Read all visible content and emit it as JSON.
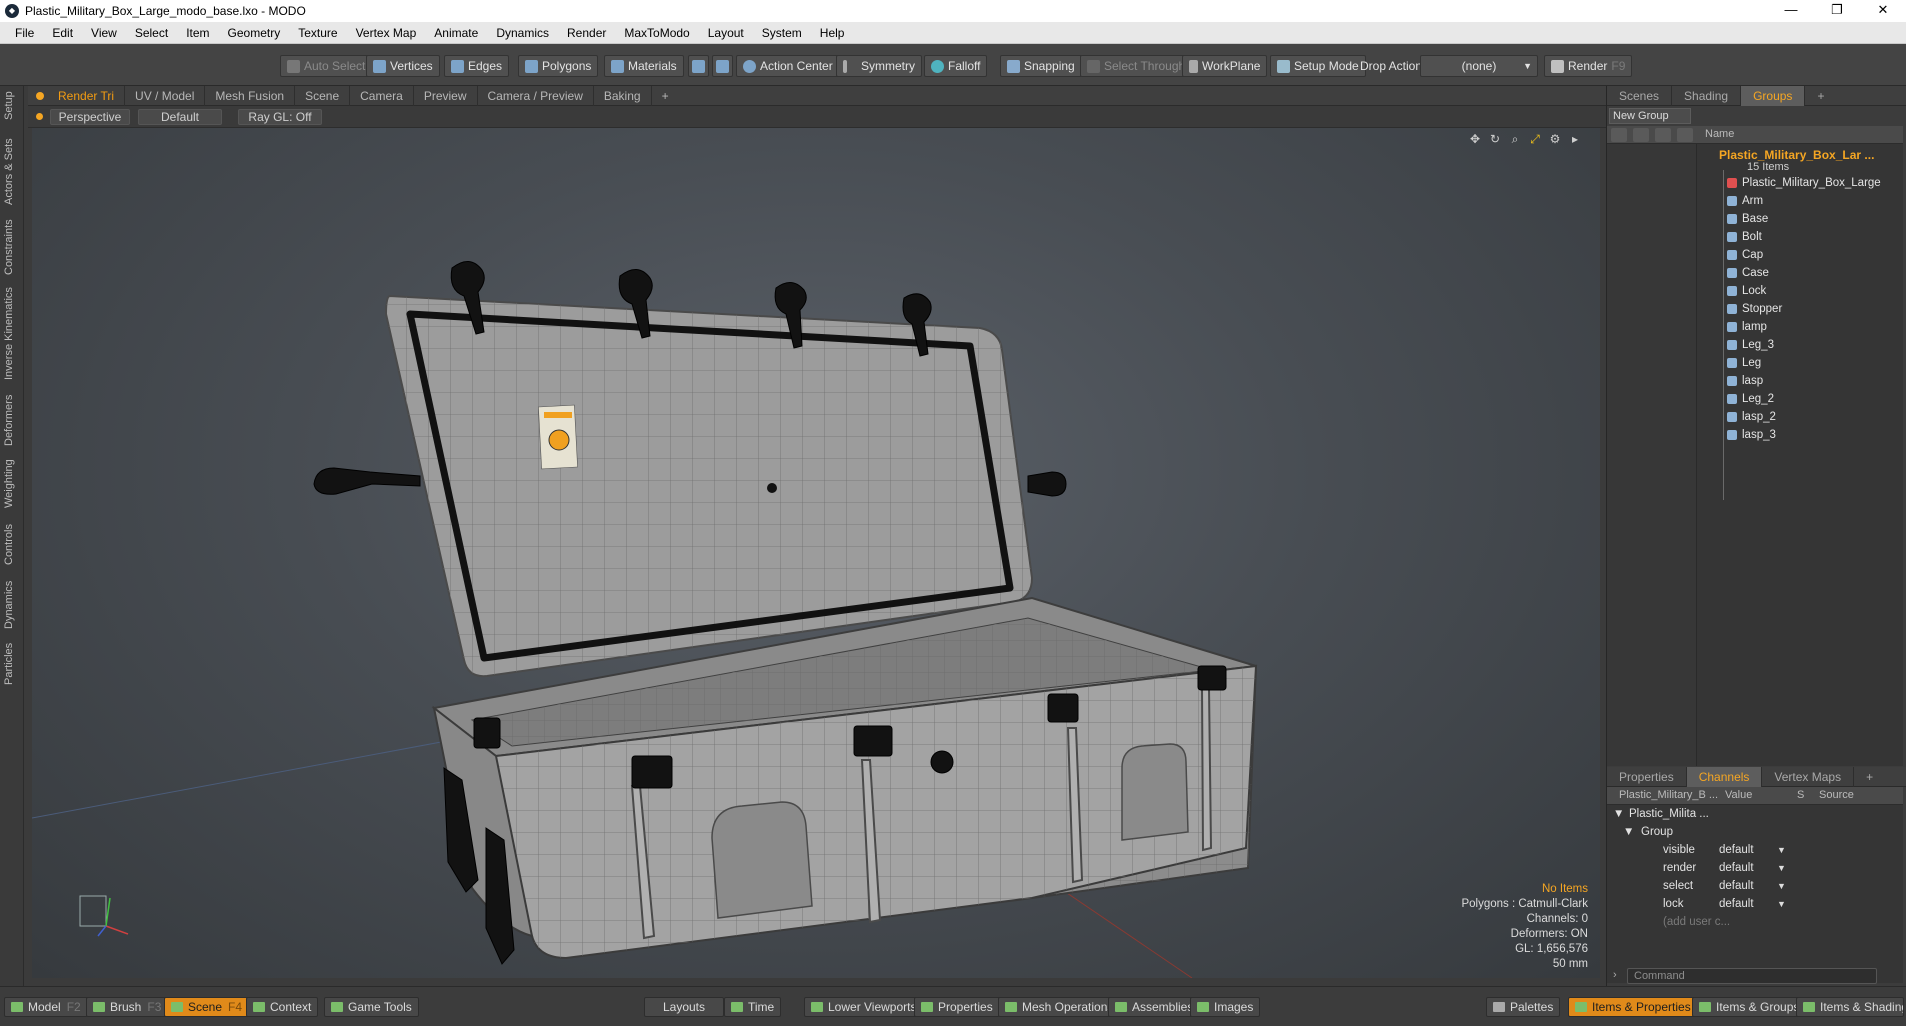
{
  "window": {
    "title": "Plastic_Military_Box_Large_modo_base.lxo - MODO",
    "minimize": "—",
    "maximize": "❐",
    "close": "✕"
  },
  "menu": [
    "File",
    "Edit",
    "View",
    "Select",
    "Item",
    "Geometry",
    "Texture",
    "Vertex Map",
    "Animate",
    "Dynamics",
    "Render",
    "MaxToModo",
    "Layout",
    "System",
    "Help"
  ],
  "toolbar": {
    "auto_select": "Auto Select",
    "vertices": "Vertices",
    "edges": "Edges",
    "polygons": "Polygons",
    "materials": "Materials",
    "action_center": "Action Center",
    "symmetry": "Symmetry",
    "falloff": "Falloff",
    "snapping": "Snapping",
    "select_through": "Select Through",
    "workplane": "WorkPlane",
    "setup_mode": "Setup Mode",
    "drop_action": "Drop Action",
    "drop_value": "(none)",
    "render": "Render",
    "render_key": "F9"
  },
  "left_tabs": [
    "Setup",
    "Actors & Sets",
    "Constraints",
    "Inverse Kinematics",
    "Deformers",
    "Weighting",
    "Controls",
    "Dynamics",
    "Particles"
  ],
  "viewport_tabs": [
    "Render Tri",
    "UV / Model",
    "Mesh Fusion",
    "Scene",
    "Camera",
    "Preview",
    "Camera / Preview",
    "Baking",
    "+"
  ],
  "viewport_opts": {
    "view": "Perspective",
    "shading": "Default",
    "raygl": "Ray GL: Off"
  },
  "stats": {
    "items": "No Items",
    "polygons": "Polygons : Catmull-Clark",
    "channels": "Channels: 0",
    "deformers": "Deformers: ON",
    "gl": "GL: 1,656,576",
    "scale": "50 mm"
  },
  "right_top_tabs": [
    "Scenes",
    "Shading",
    "Groups",
    "+"
  ],
  "groups": {
    "new_group": "New Group",
    "name_col": "Name",
    "root": "Plastic_Military_Box_Lar ...",
    "count": "15 Items",
    "items": [
      "Plastic_Military_Box_Large",
      "Arm",
      "Base",
      "Bolt",
      "Cap",
      "Case",
      "Lock",
      "Stopper",
      "lamp",
      "Leg_3",
      "Leg",
      "lasp",
      "Leg_2",
      "lasp_2",
      "lasp_3"
    ]
  },
  "right_bottom_tabs": [
    "Properties",
    "Channels",
    "Vertex Maps",
    "+"
  ],
  "channels": {
    "col_item": "Plastic_Military_B ...",
    "col_value": "Value",
    "col_s": "S",
    "col_source": "Source",
    "root": "Plastic_Milita ...",
    "group": "Group",
    "rows": [
      {
        "name": "visible",
        "value": "default"
      },
      {
        "name": "render",
        "value": "default"
      },
      {
        "name": "select",
        "value": "default"
      },
      {
        "name": "lock",
        "value": "default"
      }
    ],
    "add_user": "(add user c..."
  },
  "command_placeholder": "Command",
  "bottom": {
    "model": "Model",
    "model_key": "F2",
    "brush": "Brush",
    "brush_key": "F3",
    "scene": "Scene",
    "scene_key": "F4",
    "context": "Context",
    "game_tools": "Game Tools",
    "layouts": "Layouts",
    "time": "Time",
    "lower_viewports": "Lower Viewports",
    "properties": "Properties",
    "mesh_operations": "Mesh Operations",
    "assemblies": "Assemblies",
    "images": "Images",
    "palettes": "Palettes",
    "items_props": "Items & Properties",
    "items_groups": "Items & Groups",
    "items_shading": "Items & Shading"
  },
  "colors": {
    "accent": "#f5a623",
    "box": "#9a9a9a",
    "hardware": "#111111"
  }
}
